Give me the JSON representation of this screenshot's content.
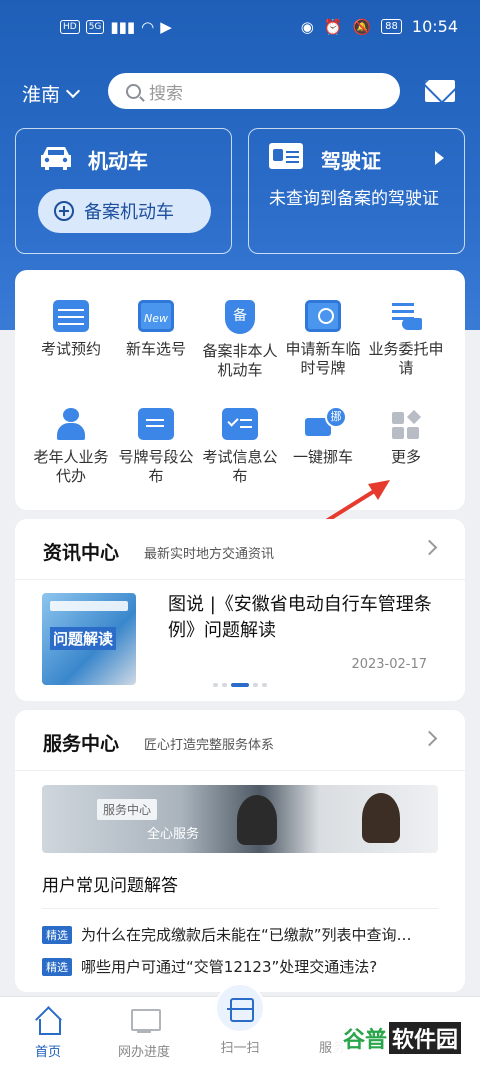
{
  "status_bar": {
    "left_chips": [
      "HD",
      "5G"
    ],
    "battery": "88",
    "time": "10:54"
  },
  "header": {
    "city": "淮南",
    "search_placeholder": "搜索",
    "mail_icon": "mail-icon"
  },
  "motor_card": {
    "title": "机动车",
    "register_button": "备案机动车"
  },
  "license_card": {
    "title": "驾驶证",
    "message": "未查询到备案的驾驶证"
  },
  "services": [
    {
      "label": "考试预约",
      "icon": "calendar-icon"
    },
    {
      "label": "新车选号",
      "icon": "new-plate-icon"
    },
    {
      "label": "备案非本人机动车",
      "icon": "shield-icon"
    },
    {
      "label": "申请新车临时号牌",
      "icon": "temp-plate-icon"
    },
    {
      "label": "业务委托申请",
      "icon": "delegate-icon"
    },
    {
      "label": "老年人业务代办",
      "icon": "elder-icon"
    },
    {
      "label": "号牌号段公布",
      "icon": "plate-icon"
    },
    {
      "label": "考试信息公布",
      "icon": "exam-icon"
    },
    {
      "label": "一键挪车",
      "icon": "truck-icon"
    },
    {
      "label": "更多",
      "icon": "more-icon"
    }
  ],
  "news": {
    "title": "资讯中心",
    "subtitle": "最新实时地方交通资讯",
    "article_title": "图说 |《安徽省电动自行车管理条例》问题解读",
    "thumb_text": "问题解读",
    "date": "2023-02-17"
  },
  "service_center": {
    "title": "服务中心",
    "subtitle": "匠心打造完整服务体系",
    "banner_chip": "服务中心",
    "banner_slogan": "全心服务",
    "faq_title": "用户常见问题解答",
    "tag": "精选",
    "faqs": [
      "为什么在完成缴款后未能在“已缴款”列表中查询…",
      "哪些用户可通过“交管12123”处理交通违法?"
    ]
  },
  "tabbar": {
    "home": "首页",
    "progress": "网办进度",
    "scan": "扫一扫",
    "service": "服务"
  },
  "watermark": {
    "part_a": "谷普",
    "part_b": "软件园"
  },
  "colors": {
    "brand_blue": "#2a6cc8",
    "annotation_red": "#e63a2e"
  }
}
